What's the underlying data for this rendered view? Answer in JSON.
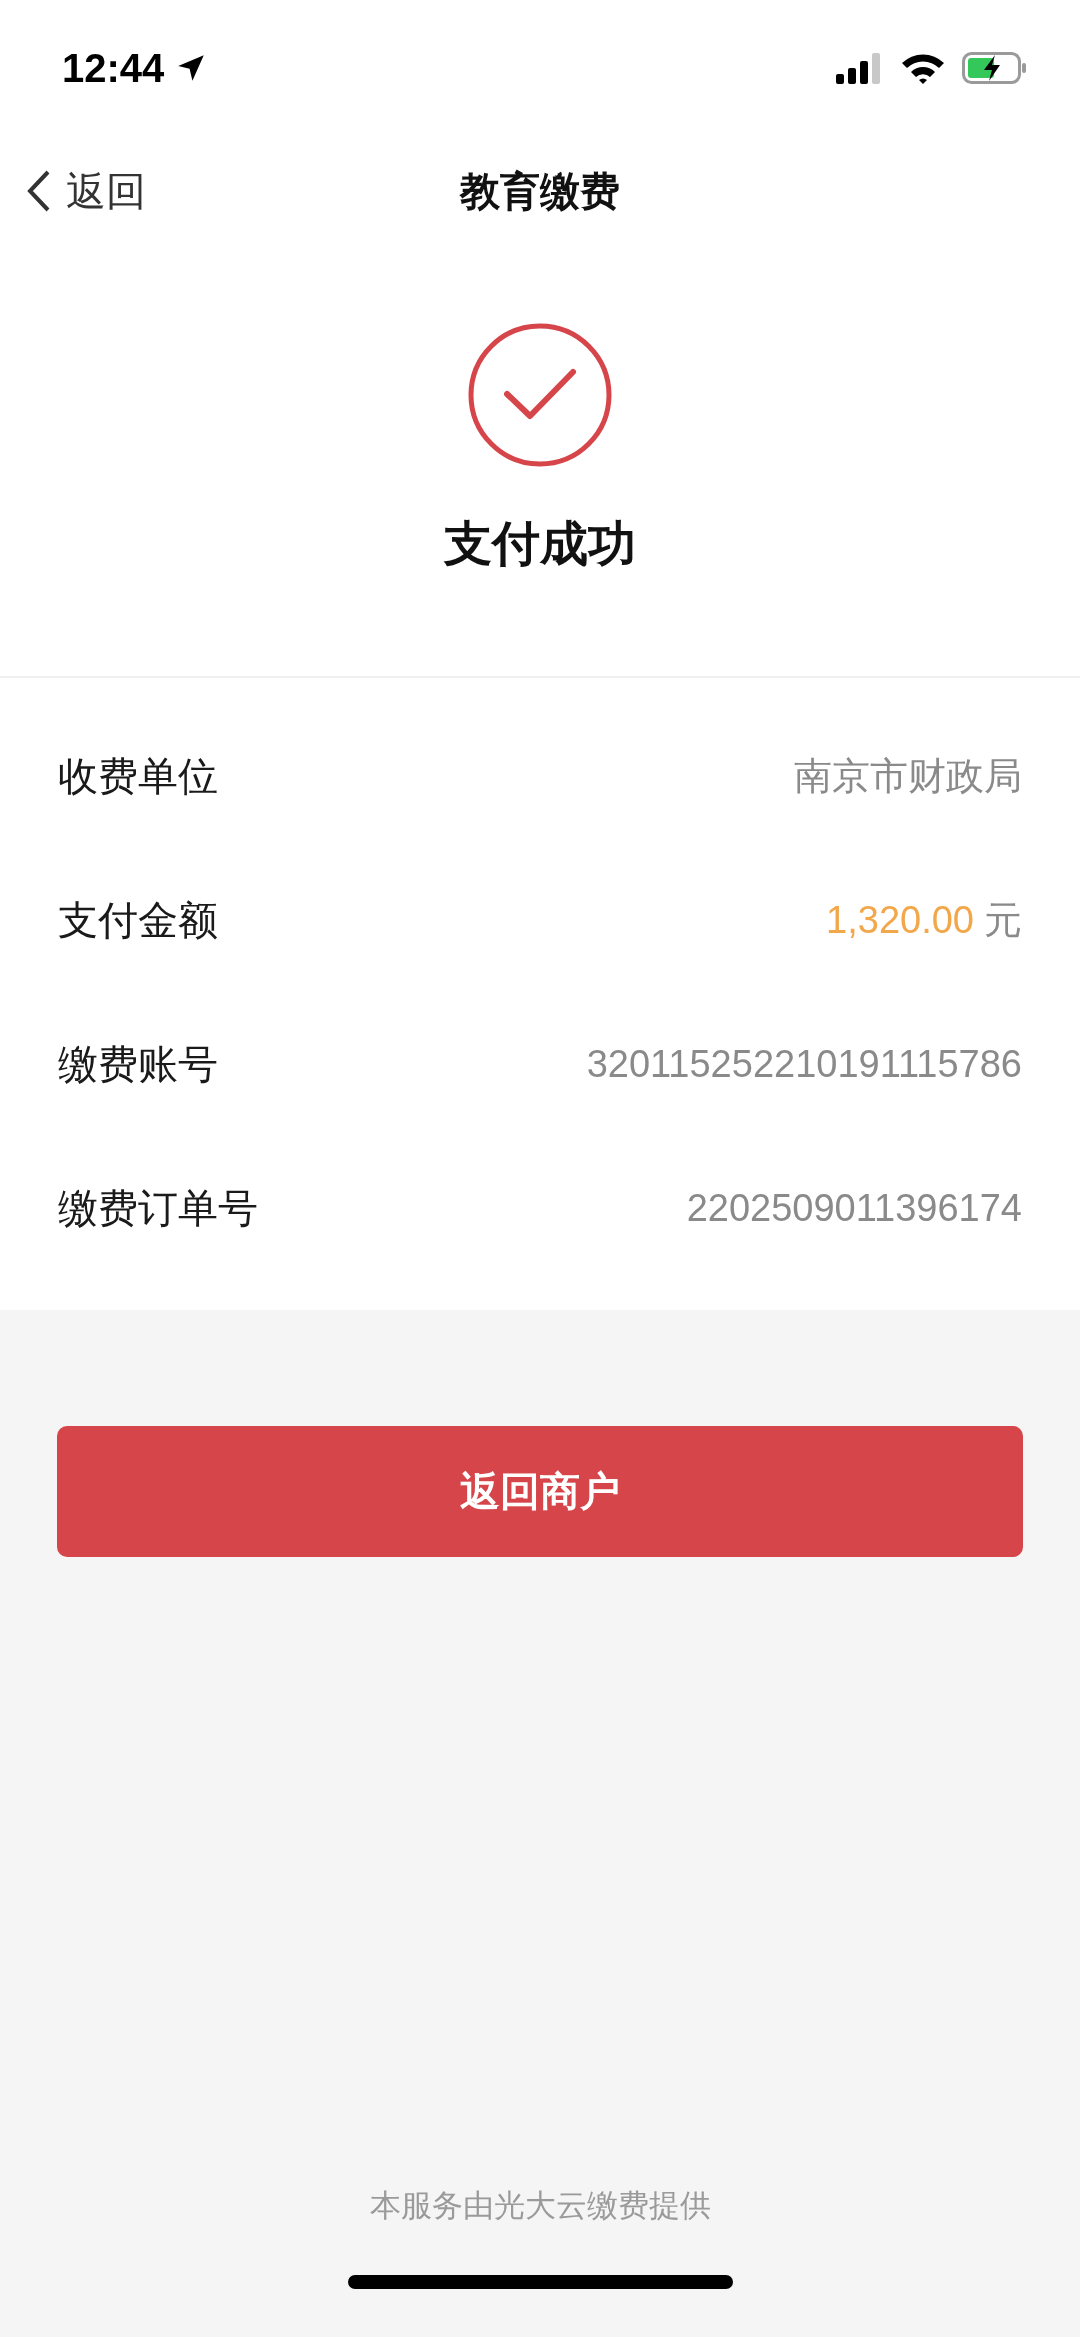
{
  "status_bar": {
    "time": "12:44"
  },
  "nav": {
    "back_label": "返回",
    "title": "教育缴费"
  },
  "result": {
    "title": "支付成功"
  },
  "details": [
    {
      "kind": "text",
      "label": "收费单位",
      "value": "南京市财政局"
    },
    {
      "kind": "amount",
      "label": "支付金额",
      "value": "1,320.00",
      "unit": "元"
    },
    {
      "kind": "text",
      "label": "缴费账号",
      "value": "320115252210191115786"
    },
    {
      "kind": "text",
      "label": "缴费订单号",
      "value": "2202509011396174"
    }
  ],
  "primary_button": "返回商户",
  "footer": "本服务由光大云缴费提供"
}
